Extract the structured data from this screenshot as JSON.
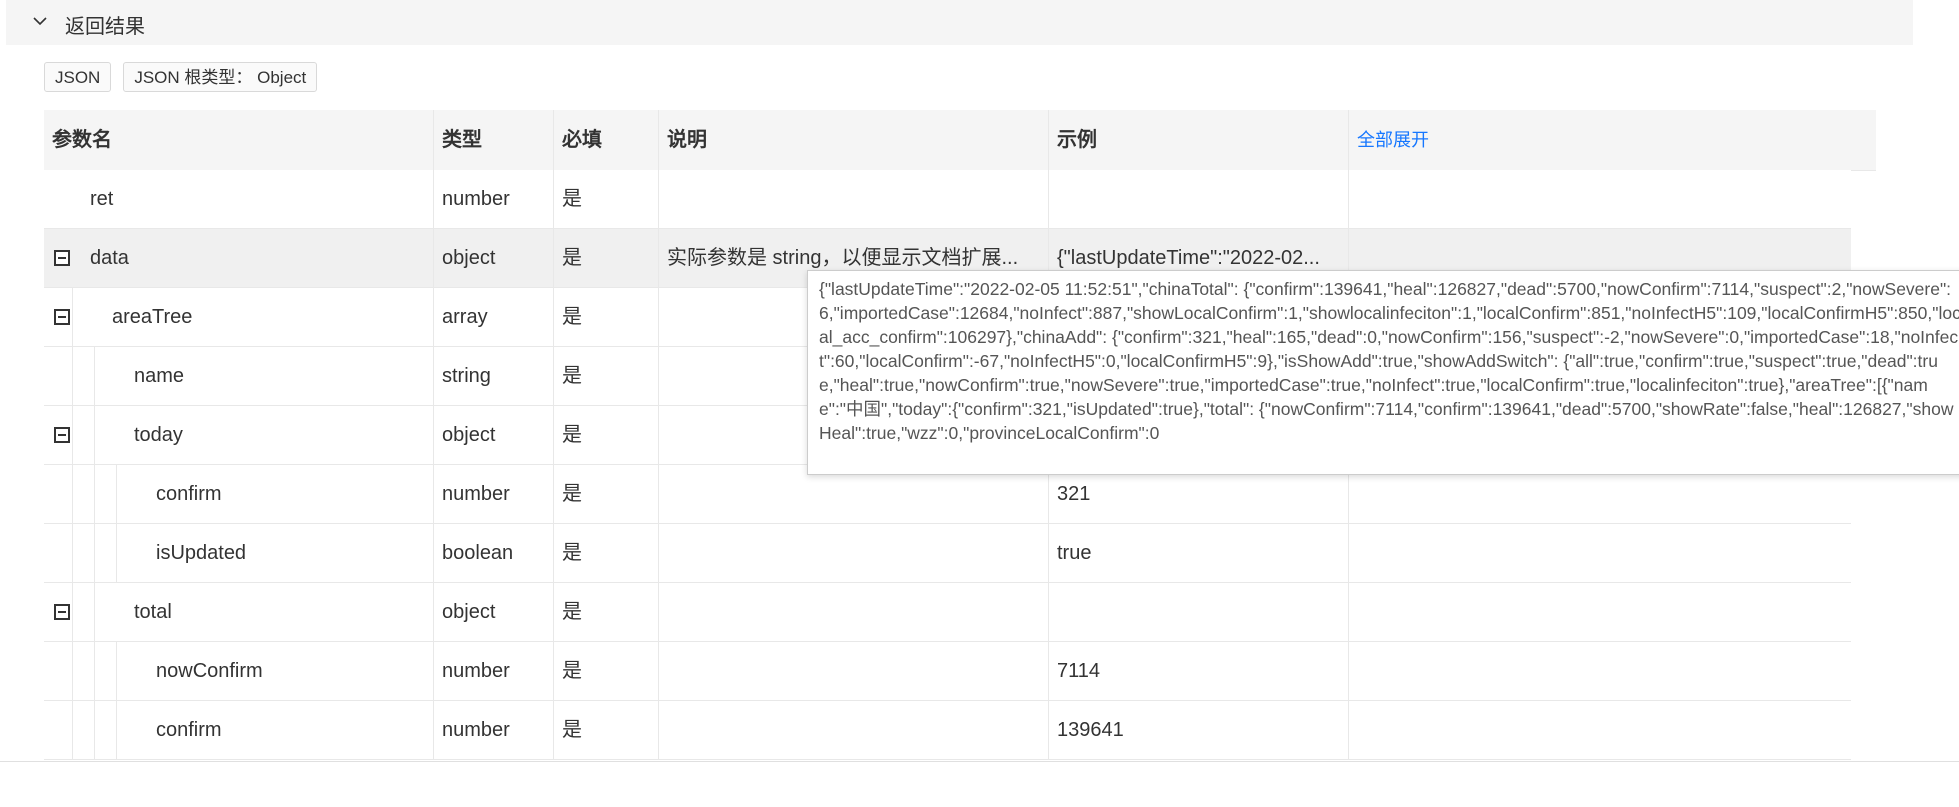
{
  "section": {
    "title": "返回结果"
  },
  "tags": {
    "format": "JSON",
    "root_type": "JSON 根类型： Object"
  },
  "table": {
    "headers": {
      "name": "参数名",
      "type": "类型",
      "required": "必填",
      "desc": "说明",
      "example": "示例",
      "expand_all": "全部展开"
    },
    "rows": [
      {
        "name": "ret",
        "type": "number",
        "required": "是",
        "desc": "",
        "example": ""
      },
      {
        "name": "data",
        "type": "object",
        "required": "是",
        "desc": "实际参数是 string，以便显示文档扩展...",
        "example": "{\"lastUpdateTime\":\"2022-02..."
      },
      {
        "name": "areaTree",
        "type": "array",
        "required": "是",
        "desc": "",
        "example": ""
      },
      {
        "name": "name",
        "type": "string",
        "required": "是",
        "desc": "",
        "example": ""
      },
      {
        "name": "today",
        "type": "object",
        "required": "是",
        "desc": "",
        "example": ""
      },
      {
        "name": "confirm",
        "type": "number",
        "required": "是",
        "desc": "",
        "example": "321"
      },
      {
        "name": "isUpdated",
        "type": "boolean",
        "required": "是",
        "desc": "",
        "example": "true"
      },
      {
        "name": "total",
        "type": "object",
        "required": "是",
        "desc": "",
        "example": ""
      },
      {
        "name": "nowConfirm",
        "type": "number",
        "required": "是",
        "desc": "",
        "example": "7114"
      },
      {
        "name": "confirm",
        "type": "number",
        "required": "是",
        "desc": "",
        "example": "139641"
      }
    ]
  },
  "tooltip": {
    "text": "{\"lastUpdateTime\":\"2022-02-05 11:52:51\",\"chinaTotal\": {\"confirm\":139641,\"heal\":126827,\"dead\":5700,\"nowConfirm\":7114,\"suspect\":2,\"nowSevere\":6,\"importedCase\":12684,\"noInfect\":887,\"showLocalConfirm\":1,\"showlocalinfeciton\":1,\"localConfirm\":851,\"noInfectH5\":109,\"localConfirmH5\":850,\"local_acc_confirm\":106297},\"chinaAdd\": {\"confirm\":321,\"heal\":165,\"dead\":0,\"nowConfirm\":156,\"suspect\":-2,\"nowSevere\":0,\"importedCase\":18,\"noInfect\":60,\"localConfirm\":-67,\"noInfectH5\":0,\"localConfirmH5\":9},\"isShowAdd\":true,\"showAddSwitch\": {\"all\":true,\"confirm\":true,\"suspect\":true,\"dead\":true,\"heal\":true,\"nowConfirm\":true,\"nowSevere\":true,\"importedCase\":true,\"noInfect\":true,\"localConfirm\":true,\"localinfeciton\":true},\"areaTree\":[{\"name\":\"中国\",\"today\":{\"confirm\":321,\"isUpdated\":true},\"total\": {\"nowConfirm\":7114,\"confirm\":139641,\"dead\":5700,\"showRate\":false,\"heal\":126827,\"showHeal\":true,\"wzz\":0,\"provinceLocalConfirm\":0"
  }
}
